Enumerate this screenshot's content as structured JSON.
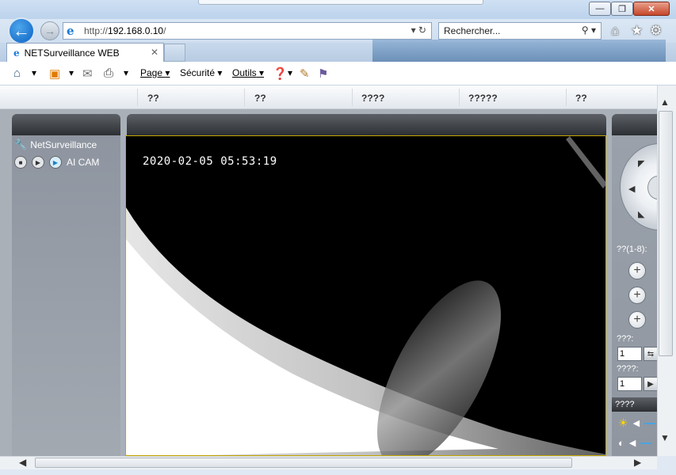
{
  "window": {
    "minimize_label": "—",
    "maximize_label": "❐",
    "close_label": "✕"
  },
  "nav": {
    "back_icon": "←",
    "forward_icon": "→",
    "address_prefix": "http://",
    "address_host": "192.168.0.10",
    "address_suffix": "/",
    "address_tools": "▾ ↻",
    "search_placeholder": "Rechercher...",
    "search_tools": "⚲ ▾",
    "home_icon": "⌂",
    "favorites_icon": "★",
    "tools_icon": "⚙"
  },
  "tabs": {
    "active_label": "NETSurveillance WEB",
    "close_glyph": "✕"
  },
  "command_bar": {
    "page_label": "Page",
    "security_label": "Sécurité",
    "tools_label": "Outils",
    "dropdown_glyph": "▾"
  },
  "app_menu": {
    "items": [
      "??",
      "??",
      "????",
      "?????",
      "??"
    ]
  },
  "device_tree": {
    "root_label": "NetSurveillance",
    "device_label": "AI CAM"
  },
  "video": {
    "timestamp": "2020-02-05 05:53:19"
  },
  "ptz_panel": {
    "preset_label": "??(1-8):",
    "plus_glyph": "+",
    "field1_label": "???:",
    "field1_value": "1",
    "field2_label": "????:",
    "field2_value": "1",
    "color_header": "????"
  },
  "scroll": {
    "up": "▲",
    "down": "▼",
    "left": "◀",
    "right": "▶"
  }
}
